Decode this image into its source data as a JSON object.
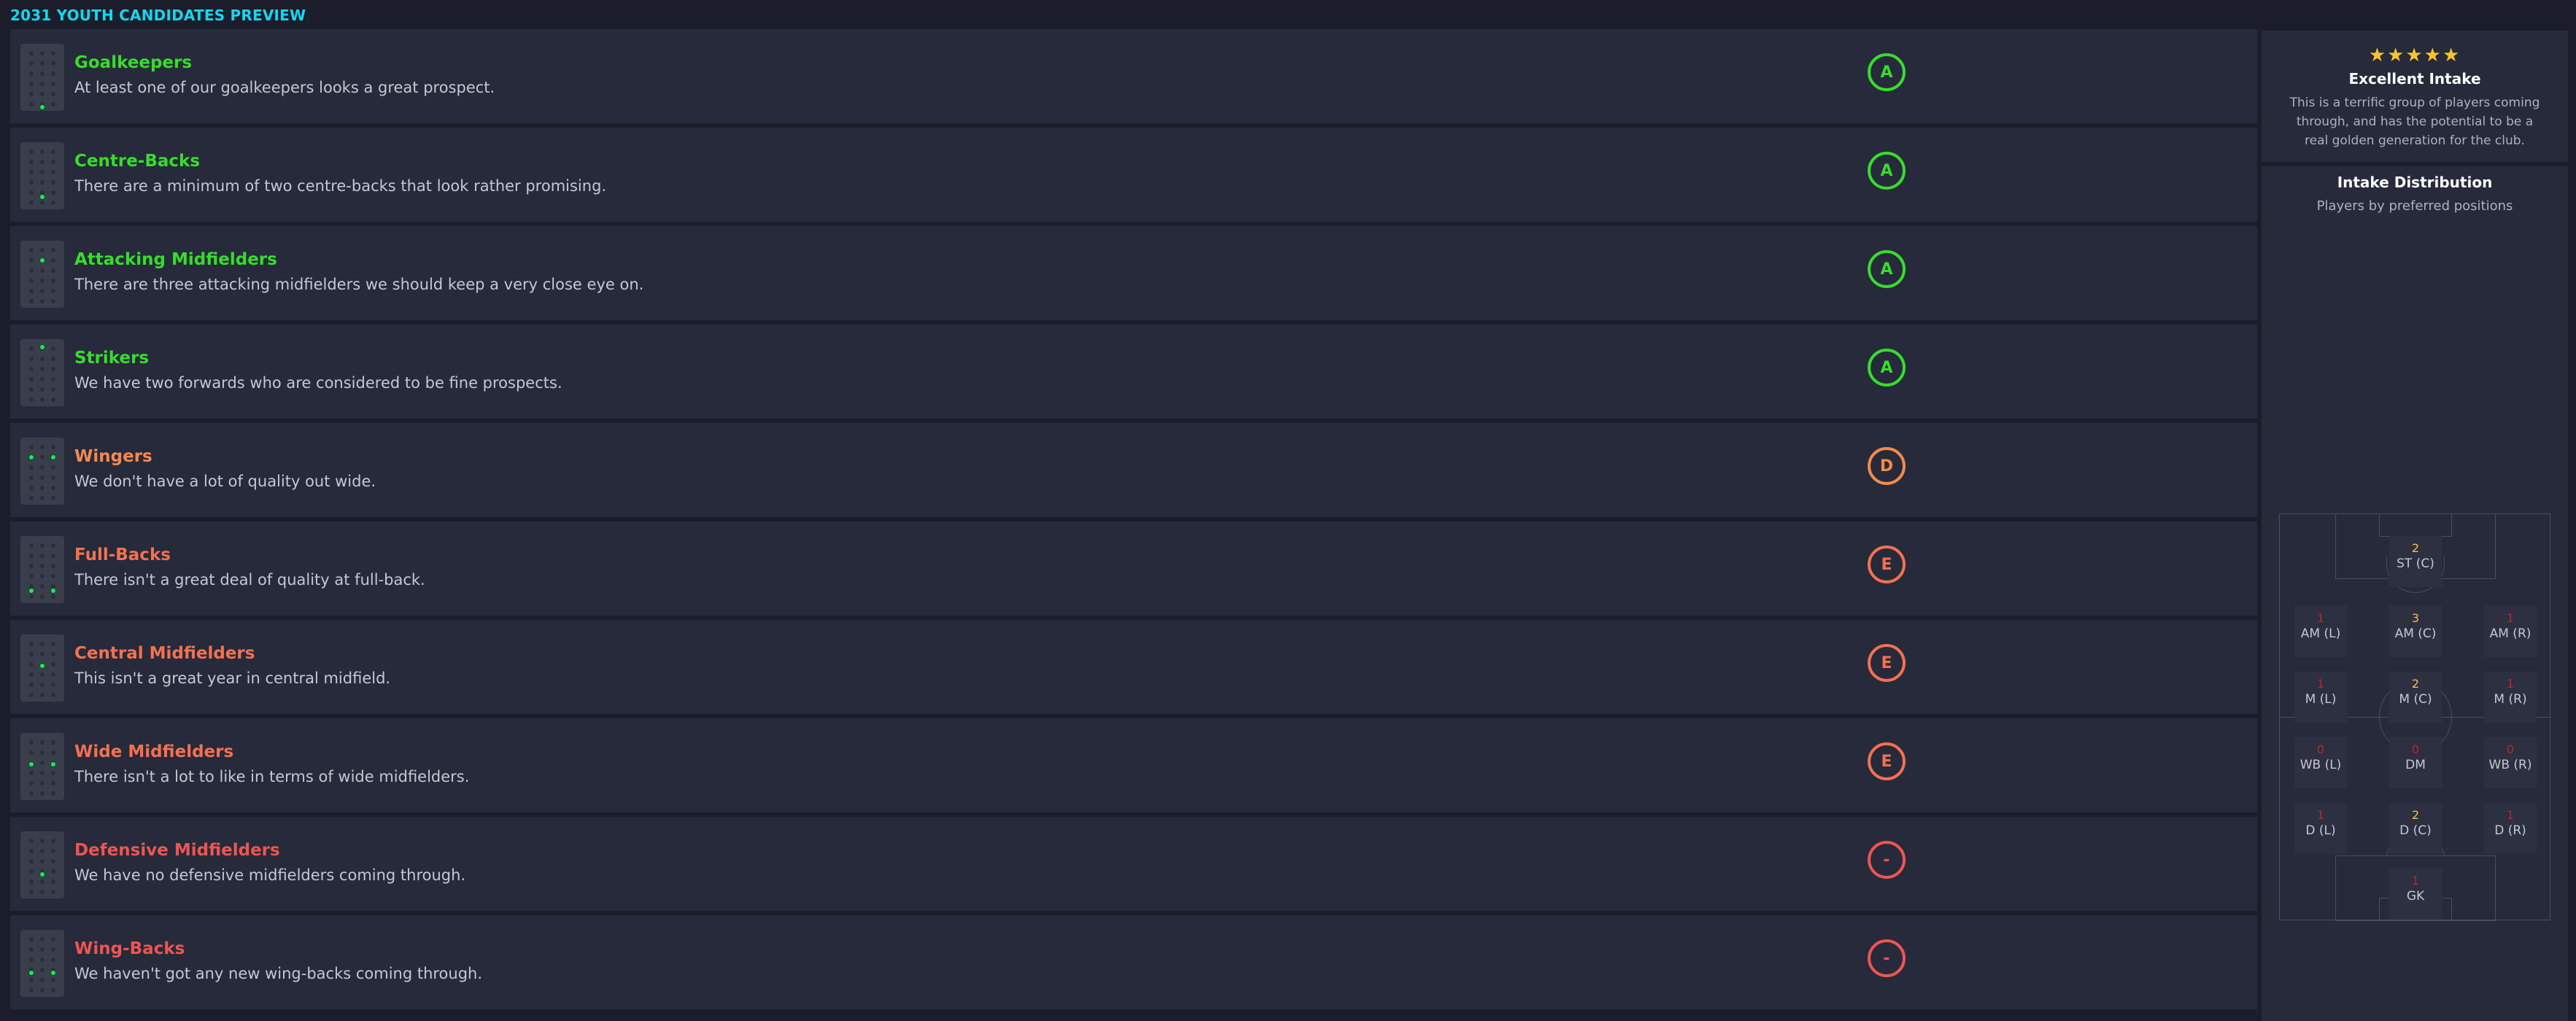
{
  "header": {
    "title": "2031 YOUTH CANDIDATES PREVIEW"
  },
  "colors": {
    "header": "#17d6f0",
    "grade_a": "#37dd2c",
    "grade_d": "#f5894d",
    "grade_e": "#f4714f",
    "grade_none": "#ee5553",
    "dot_on": "#25e35a"
  },
  "rows": [
    {
      "title": "Goalkeepers",
      "desc": "At least one of our goalkeepers looks a great prospect.",
      "grade": "A",
      "color": "c-green",
      "dots": [
        "gk"
      ]
    },
    {
      "title": "Centre-Backs",
      "desc": "There are a minimum of two centre-backs that look rather promising.",
      "grade": "A",
      "color": "c-green",
      "dots": [
        "dc"
      ]
    },
    {
      "title": "Attacking Midfielders",
      "desc": "There are three attacking midfielders we should keep a very close eye on.",
      "grade": "A",
      "color": "c-green",
      "dots": [
        "amc"
      ]
    },
    {
      "title": "Strikers",
      "desc": "We have two forwards who are considered to be fine prospects.",
      "grade": "A",
      "color": "c-green",
      "dots": [
        "st"
      ]
    },
    {
      "title": "Wingers",
      "desc": "We don't have a lot of quality out wide.",
      "grade": "D",
      "color": "c-orange",
      "dots": [
        "aml",
        "amr"
      ]
    },
    {
      "title": "Full-Backs",
      "desc": "There isn't a great deal of quality at full-back.",
      "grade": "E",
      "color": "c-coral",
      "dots": [
        "dl",
        "dr"
      ]
    },
    {
      "title": "Central Midfielders",
      "desc": "This isn't a great year in central midfield.",
      "grade": "E",
      "color": "c-coral",
      "dots": [
        "mc"
      ]
    },
    {
      "title": "Wide Midfielders",
      "desc": "There isn't a lot to like in terms of wide midfielders.",
      "grade": "E",
      "color": "c-coral",
      "dots": [
        "ml",
        "mr"
      ]
    },
    {
      "title": "Defensive Midfielders",
      "desc": "We have no defensive midfielders coming through.",
      "grade": "-",
      "color": "c-red",
      "dots": [
        "dm"
      ]
    },
    {
      "title": "Wing-Backs",
      "desc": "We haven't got any new wing-backs coming through.",
      "grade": "-",
      "color": "c-red",
      "dots": [
        "wbl",
        "wbr"
      ]
    }
  ],
  "summary": {
    "stars": "★★★★★",
    "title": "Excellent Intake",
    "text": "This is a terrific group of players coming through, and has the potential to be a real golden generation for the club."
  },
  "distribution": {
    "title": "Intake Distribution",
    "subtitle": "Players by preferred positions",
    "positions": [
      {
        "key": "st",
        "label": "ST (C)",
        "count": "2"
      },
      {
        "key": "aml",
        "label": "AM (L)",
        "count": "1"
      },
      {
        "key": "amc",
        "label": "AM (C)",
        "count": "3"
      },
      {
        "key": "amr",
        "label": "AM (R)",
        "count": "1"
      },
      {
        "key": "ml",
        "label": "M (L)",
        "count": "1"
      },
      {
        "key": "mc",
        "label": "M (C)",
        "count": "2"
      },
      {
        "key": "mr",
        "label": "M (R)",
        "count": "1"
      },
      {
        "key": "wbl",
        "label": "WB (L)",
        "count": "0"
      },
      {
        "key": "dm",
        "label": "DM",
        "count": "0"
      },
      {
        "key": "wbr",
        "label": "WB (R)",
        "count": "0"
      },
      {
        "key": "dl",
        "label": "D (L)",
        "count": "1"
      },
      {
        "key": "dc",
        "label": "D (C)",
        "count": "2"
      },
      {
        "key": "dr",
        "label": "D (R)",
        "count": "1"
      },
      {
        "key": "gk",
        "label": "GK",
        "count": "1"
      }
    ]
  }
}
